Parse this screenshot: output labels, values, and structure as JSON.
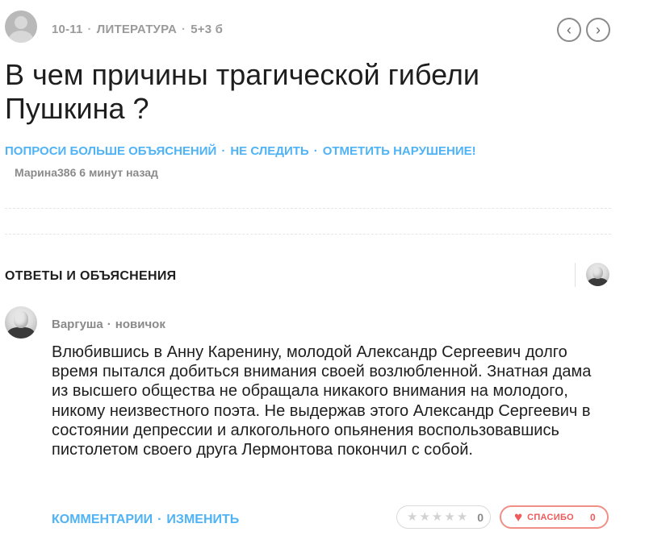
{
  "question": {
    "grade": "10-11",
    "subject": "ЛИТЕРАТУРА",
    "points": "5+3 б",
    "title": "В чем причины трагической гибели Пушкина ?",
    "author": "Марина386",
    "time": "6 минут назад",
    "actions": {
      "ask_more": "ПОПРОСИ БОЛЬШЕ ОБЪЯСНЕНИЙ",
      "unfollow": "НЕ СЛЕДИТЬ",
      "report": "ОТМЕТИТЬ НАРУШЕНИЕ!"
    },
    "meta_separator": "·"
  },
  "nav": {
    "prev_icon": "chevron-left-icon",
    "next_icon": "chevron-right-icon"
  },
  "answers_section": {
    "title": "ОТВЕТЫ И ОБЪЯСНЕНИЯ"
  },
  "answer": {
    "author": "Варгуша",
    "rank": "новичок",
    "text": "Влюбившись в Анну Каренину, молодой Александр Сергеевич долго время пытался добиться внимания своей возлюбленной. Знатная дама из высшего общества не обращала никакого внимания на молодого, никому неизвестного поэта. Не выдержав этого Александр Сергеевич в состоянии депрессии и алкогольного опьянения воспользовавшись пистолетом своего друга Лермонтова покончил с собой.",
    "comments_label": "КОММЕНТАРИИ",
    "edit_label": "ИЗМЕНИТЬ",
    "rating_count": "0",
    "rating_stars": 5,
    "thanks_label": "СПАСИБО",
    "thanks_count": "0"
  },
  "colors": {
    "link": "#4fb3f6",
    "muted": "#8a8a8a",
    "thanks": "#ef5a5a"
  }
}
